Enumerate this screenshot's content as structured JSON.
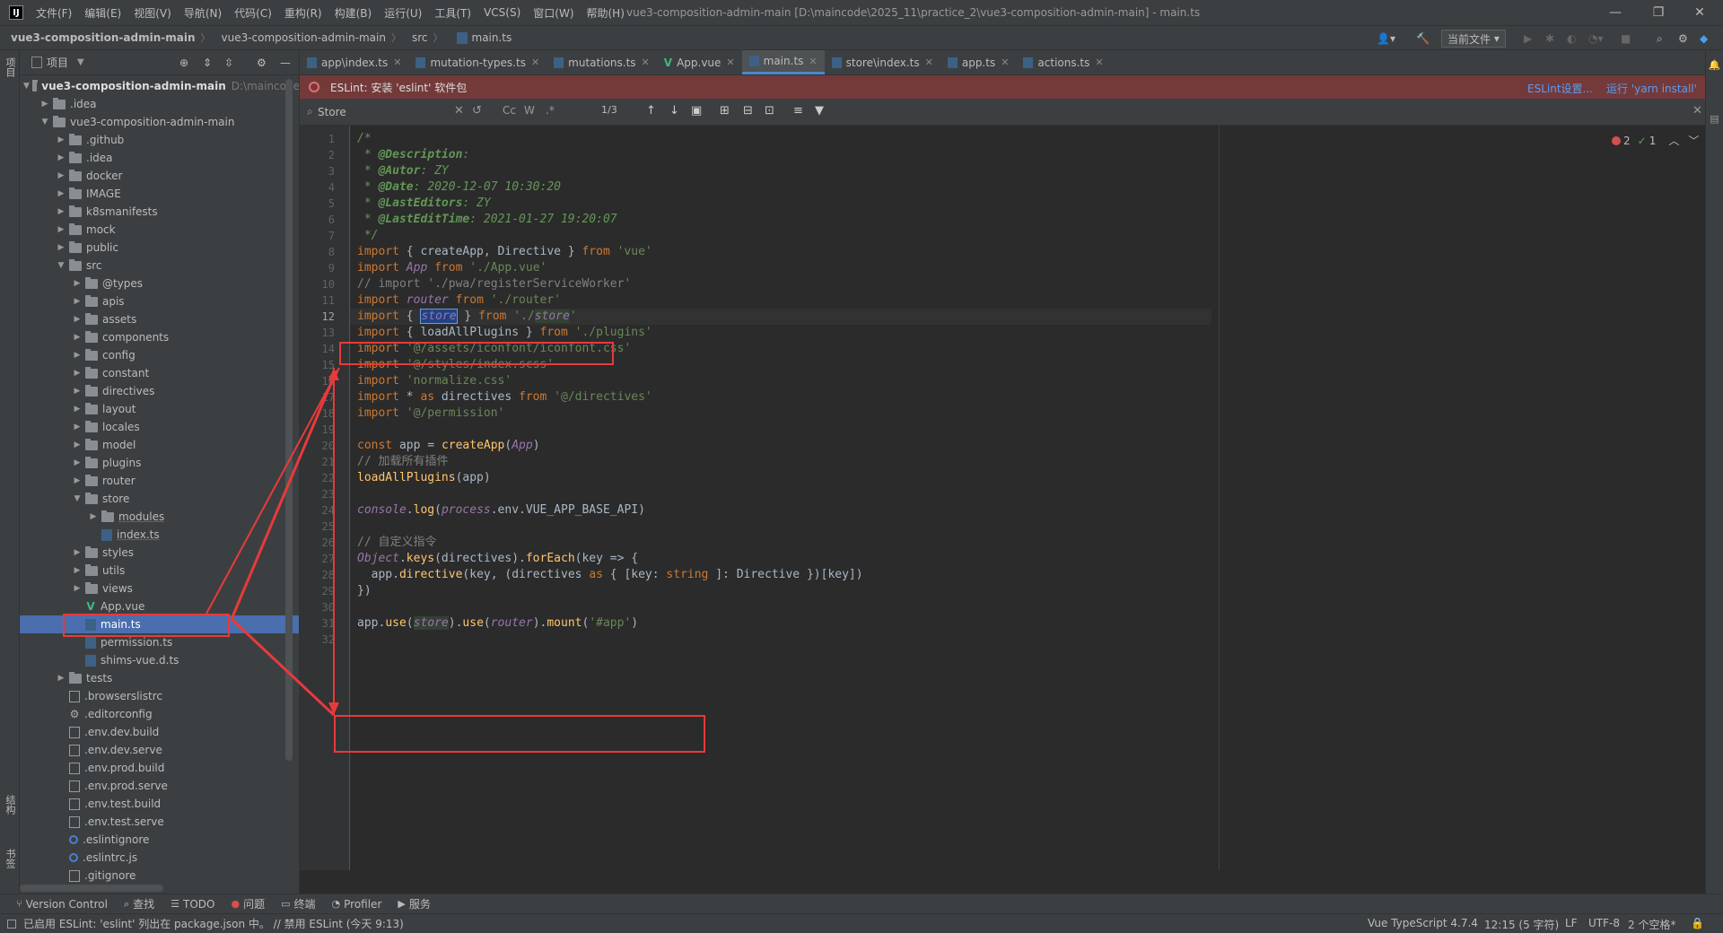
{
  "menu": {
    "logo": "IJ",
    "items": [
      "文件(F)",
      "编辑(E)",
      "视图(V)",
      "导航(N)",
      "代码(C)",
      "重构(R)",
      "构建(B)",
      "运行(U)",
      "工具(T)",
      "VCS(S)",
      "窗口(W)",
      "帮助(H)"
    ],
    "window_title": "vue3-composition-admin-main [D:\\maincode\\2025_11\\practice_2\\vue3-composition-admin-main] - main.ts"
  },
  "breadcrumb": [
    "vue3-composition-admin-main",
    "vue3-composition-admin-main",
    "src",
    "main.ts"
  ],
  "toolbar": {
    "run_config": "当前文件"
  },
  "left_strip": {
    "top_label": "项目",
    "mid_label": "结构",
    "bottom_label": "书签"
  },
  "project_panel": {
    "title": "项目",
    "root": "vue3-composition-admin-main",
    "root_path": "D:\\maincode",
    "tree": [
      {
        "label": ".idea",
        "depth": 1,
        "type": "folder",
        "expanded": false
      },
      {
        "label": "vue3-composition-admin-main",
        "depth": 1,
        "type": "folder",
        "expanded": true
      },
      {
        "label": ".github",
        "depth": 2,
        "type": "folder",
        "expanded": false
      },
      {
        "label": ".idea",
        "depth": 2,
        "type": "folder",
        "expanded": false
      },
      {
        "label": "docker",
        "depth": 2,
        "type": "folder",
        "expanded": false
      },
      {
        "label": "IMAGE",
        "depth": 2,
        "type": "folder",
        "expanded": false
      },
      {
        "label": "k8smanifests",
        "depth": 2,
        "type": "folder",
        "expanded": false
      },
      {
        "label": "mock",
        "depth": 2,
        "type": "folder",
        "expanded": false
      },
      {
        "label": "public",
        "depth": 2,
        "type": "folder",
        "expanded": false
      },
      {
        "label": "src",
        "depth": 2,
        "type": "folder",
        "expanded": true
      },
      {
        "label": "@types",
        "depth": 3,
        "type": "folder",
        "expanded": false
      },
      {
        "label": "apis",
        "depth": 3,
        "type": "folder",
        "expanded": false
      },
      {
        "label": "assets",
        "depth": 3,
        "type": "folder",
        "expanded": false
      },
      {
        "label": "components",
        "depth": 3,
        "type": "folder",
        "expanded": false
      },
      {
        "label": "config",
        "depth": 3,
        "type": "folder",
        "expanded": false
      },
      {
        "label": "constant",
        "depth": 3,
        "type": "folder",
        "expanded": false
      },
      {
        "label": "directives",
        "depth": 3,
        "type": "folder",
        "expanded": false
      },
      {
        "label": "layout",
        "depth": 3,
        "type": "folder",
        "expanded": false
      },
      {
        "label": "locales",
        "depth": 3,
        "type": "folder",
        "expanded": false
      },
      {
        "label": "model",
        "depth": 3,
        "type": "folder",
        "expanded": false
      },
      {
        "label": "plugins",
        "depth": 3,
        "type": "folder",
        "expanded": false
      },
      {
        "label": "router",
        "depth": 3,
        "type": "folder",
        "expanded": false
      },
      {
        "label": "store",
        "depth": 3,
        "type": "folder",
        "expanded": true
      },
      {
        "label": "modules",
        "depth": 4,
        "type": "folder",
        "expanded": false,
        "underline": true
      },
      {
        "label": "index.ts",
        "depth": 4,
        "type": "ts",
        "underline": true
      },
      {
        "label": "styles",
        "depth": 3,
        "type": "folder",
        "expanded": false
      },
      {
        "label": "utils",
        "depth": 3,
        "type": "folder",
        "expanded": false
      },
      {
        "label": "views",
        "depth": 3,
        "type": "folder",
        "expanded": false
      },
      {
        "label": "App.vue",
        "depth": 3,
        "type": "vue"
      },
      {
        "label": "main.ts",
        "depth": 3,
        "type": "ts",
        "selected": true,
        "underline": true
      },
      {
        "label": "permission.ts",
        "depth": 3,
        "type": "ts"
      },
      {
        "label": "shims-vue.d.ts",
        "depth": 3,
        "type": "ts"
      },
      {
        "label": "tests",
        "depth": 2,
        "type": "folder",
        "expanded": false
      },
      {
        "label": ".browserslistrc",
        "depth": 2,
        "type": "file"
      },
      {
        "label": ".editorconfig",
        "depth": 2,
        "type": "gear"
      },
      {
        "label": ".env.dev.build",
        "depth": 2,
        "type": "file"
      },
      {
        "label": ".env.dev.serve",
        "depth": 2,
        "type": "file"
      },
      {
        "label": ".env.prod.build",
        "depth": 2,
        "type": "file"
      },
      {
        "label": ".env.prod.serve",
        "depth": 2,
        "type": "file"
      },
      {
        "label": ".env.test.build",
        "depth": 2,
        "type": "file"
      },
      {
        "label": ".env.test.serve",
        "depth": 2,
        "type": "file"
      },
      {
        "label": ".eslintignore",
        "depth": 2,
        "type": "circle"
      },
      {
        "label": ".eslintrc.js",
        "depth": 2,
        "type": "circle"
      },
      {
        "label": ".gitignore",
        "depth": 2,
        "type": "file"
      }
    ]
  },
  "tabs": [
    {
      "label": "app\\index.ts",
      "type": "ts"
    },
    {
      "label": "mutation-types.ts",
      "type": "ts"
    },
    {
      "label": "mutations.ts",
      "type": "ts"
    },
    {
      "label": "App.vue",
      "type": "vue"
    },
    {
      "label": "main.ts",
      "type": "ts",
      "active": true
    },
    {
      "label": "store\\index.ts",
      "type": "ts"
    },
    {
      "label": "app.ts",
      "type": "ts"
    },
    {
      "label": "actions.ts",
      "type": "ts"
    }
  ],
  "eslint_bar": {
    "message": "ESLint: 安装 'eslint' 软件包",
    "link_settings": "ESLint设置...",
    "link_install": "运行 'yarn install'"
  },
  "search": {
    "value": "Store",
    "match_count": "1/3",
    "case_label": "Cc",
    "word_label": "W",
    "regex_label": ".*"
  },
  "editor": {
    "error_count": "2",
    "ok_count": "1",
    "current_line": 12,
    "lines": [
      "/*",
      " * @Description:",
      " * @Autor: ZY",
      " * @Date: 2020-12-07 10:30:20",
      " * @LastEditors: ZY",
      " * @LastEditTime: 2021-01-27 19:20:07",
      " */",
      "import { createApp, Directive } from 'vue'",
      "import App from './App.vue'",
      "// import './pwa/registerServiceWorker'",
      "import router from './router'",
      "import { store } from './store'",
      "import { loadAllPlugins } from './plugins'",
      "import '@/assets/iconfont/iconfont.css'",
      "import '@/styles/index.scss'",
      "import 'normalize.css'",
      "import * as directives from '@/directives'",
      "import '@/permission'",
      "",
      "const app = createApp(App)",
      "// 加载所有插件",
      "loadAllPlugins(app)",
      "",
      "console.log(process.env.VUE_APP_BASE_API)",
      "",
      "// 自定义指令",
      "Object.keys(directives).forEach(key => {",
      "  app.directive(key, (directives as { [key: string ]: Directive })[key])",
      "})",
      "",
      "app.use(store).use(router).mount('#app')",
      ""
    ]
  },
  "bottom_tools": [
    "Version Control",
    "查找",
    "TODO",
    "问题",
    "终端",
    "Profiler",
    "服务"
  ],
  "status": {
    "message": "已启用 ESLint: 'eslint' 列出在 package.json 中。 // 禁用 ESLint (今天 9:13)",
    "language": "Vue TypeScript 4.7.4",
    "position": "12:15 (5 字符)",
    "line_sep": "LF",
    "encoding": "UTF-8",
    "indent": "2 个空格*"
  },
  "colors": {
    "accent": "#4a88c7",
    "selection": "#4b6eaf",
    "annotation": "#e83a3a",
    "eslint_bg": "#743a3a"
  }
}
